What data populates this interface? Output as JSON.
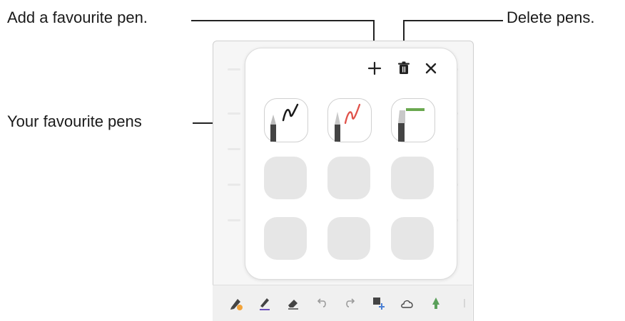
{
  "callouts": {
    "add_pen": "Add a favourite pen.",
    "delete_pens": "Delete pens.",
    "favourite_pens": "Your favourite pens"
  },
  "panel": {
    "actions": [
      "plus-icon",
      "trash-icon",
      "close-icon"
    ],
    "favourite_slots": [
      {
        "icon": "fountain-pen-icon",
        "stroke_color": "#1a1a1a"
      },
      {
        "icon": "marker-pen-icon",
        "stroke_color": "#e0524a"
      },
      {
        "icon": "highlighter-pen-icon",
        "stroke_color": "#6aa84f"
      }
    ],
    "empty_slot_count": 6
  },
  "toolbar": {
    "tools": [
      "pen-mode-icon",
      "pen-icon",
      "eraser-icon",
      "undo-icon",
      "redo-icon",
      "insert-icon",
      "shape-icon",
      "tree-icon",
      "more-icon"
    ]
  },
  "colors": {
    "panel_bg": "#ffffff",
    "empty_slot": "#e6e6e6",
    "accent_orange": "#f2a33a",
    "highlighter_green": "#6aa84f",
    "marker_red": "#e0524a"
  }
}
